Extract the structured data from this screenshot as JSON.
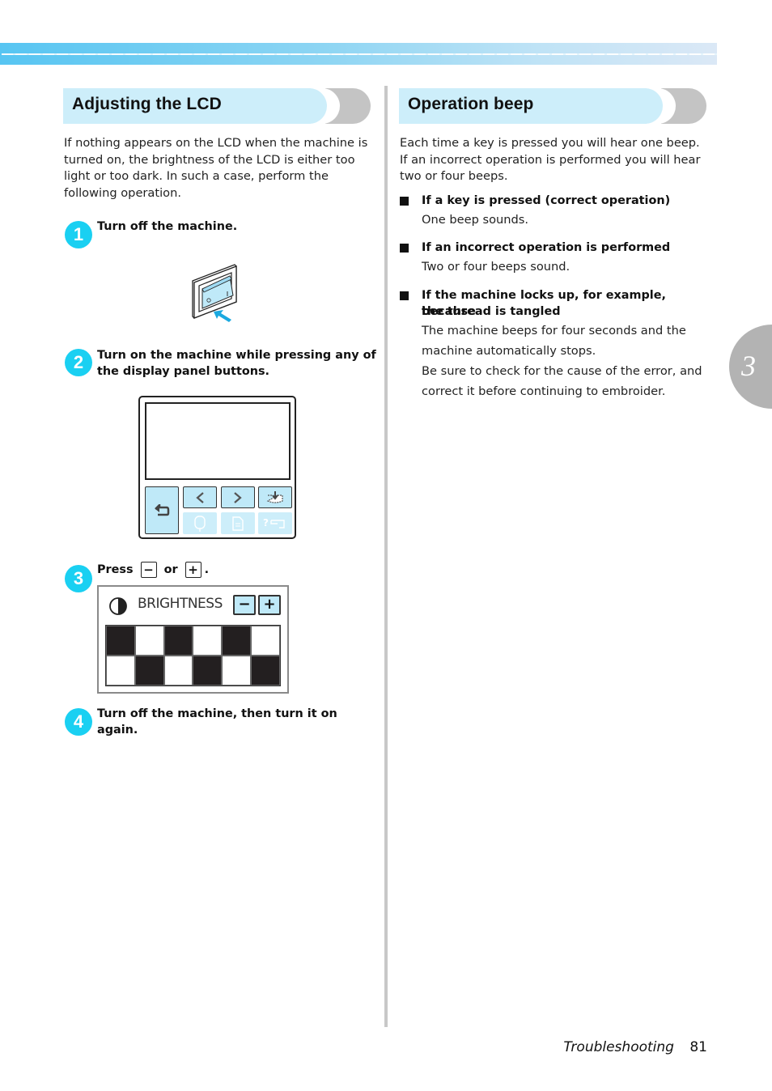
{
  "chapter_tab": {
    "number": "3"
  },
  "left": {
    "heading": "Adjusting the LCD",
    "intro": "If nothing appears on the LCD when the machine is turned on, the brightness of the LCD is either too light or too dark. In such a case, perform the following operation.",
    "steps": [
      {
        "number": "1",
        "text": "Turn off the machine."
      },
      {
        "number": "2",
        "text": "Turn on the machine while pressing any of the display panel buttons."
      },
      {
        "number": "3",
        "text_before": "Press",
        "key_minus": "−",
        "text_or": "or",
        "key_plus": "+",
        "text_after": "."
      },
      {
        "number": "4",
        "text": "Turn off the machine, then turn it on again."
      }
    ],
    "switch_illustration": {
      "off_mark": "O",
      "on_mark": "I",
      "arrow_color": "#1aa9e0"
    },
    "panel_illustration": {
      "buttons": [
        "back-icon",
        "previous-icon",
        "next-icon",
        "save-to-pocket-icon",
        "embroidery-hoop-icon",
        "document-icon",
        "help-machine-icon"
      ]
    },
    "brightness_screen": {
      "label": "BRIGHTNESS",
      "minus": "−",
      "plus": "+",
      "pattern": [
        [
          "b",
          "w",
          "b",
          "w",
          "b",
          "w"
        ],
        [
          "w",
          "b",
          "w",
          "b",
          "w",
          "b"
        ]
      ]
    }
  },
  "right": {
    "heading": "Operation beep",
    "intro": "Each time a key is pressed you will hear one beep. If an incorrect operation is performed you will hear two or four beeps.",
    "items": [
      {
        "title": "If a key is pressed (correct operation)",
        "body": [
          "One beep sounds."
        ]
      },
      {
        "title": "If an incorrect operation is performed",
        "body": [
          "Two or four beeps sound."
        ]
      },
      {
        "title_line1": "If the machine locks up, for example, because",
        "title_line2": "the thread is tangled",
        "body": [
          "The machine beeps for four seconds and the",
          "machine automatically stops.",
          "Be sure to check for the cause of the error, and",
          "correct it before continuing to embroider."
        ]
      }
    ]
  },
  "footer": {
    "section": "Troubleshooting",
    "page": "81"
  },
  "colors": {
    "accent": "#1ad0f2",
    "heading_bg": "#cdeefa",
    "band_start": "#57c5f2",
    "band_end": "#dbe8f6"
  }
}
